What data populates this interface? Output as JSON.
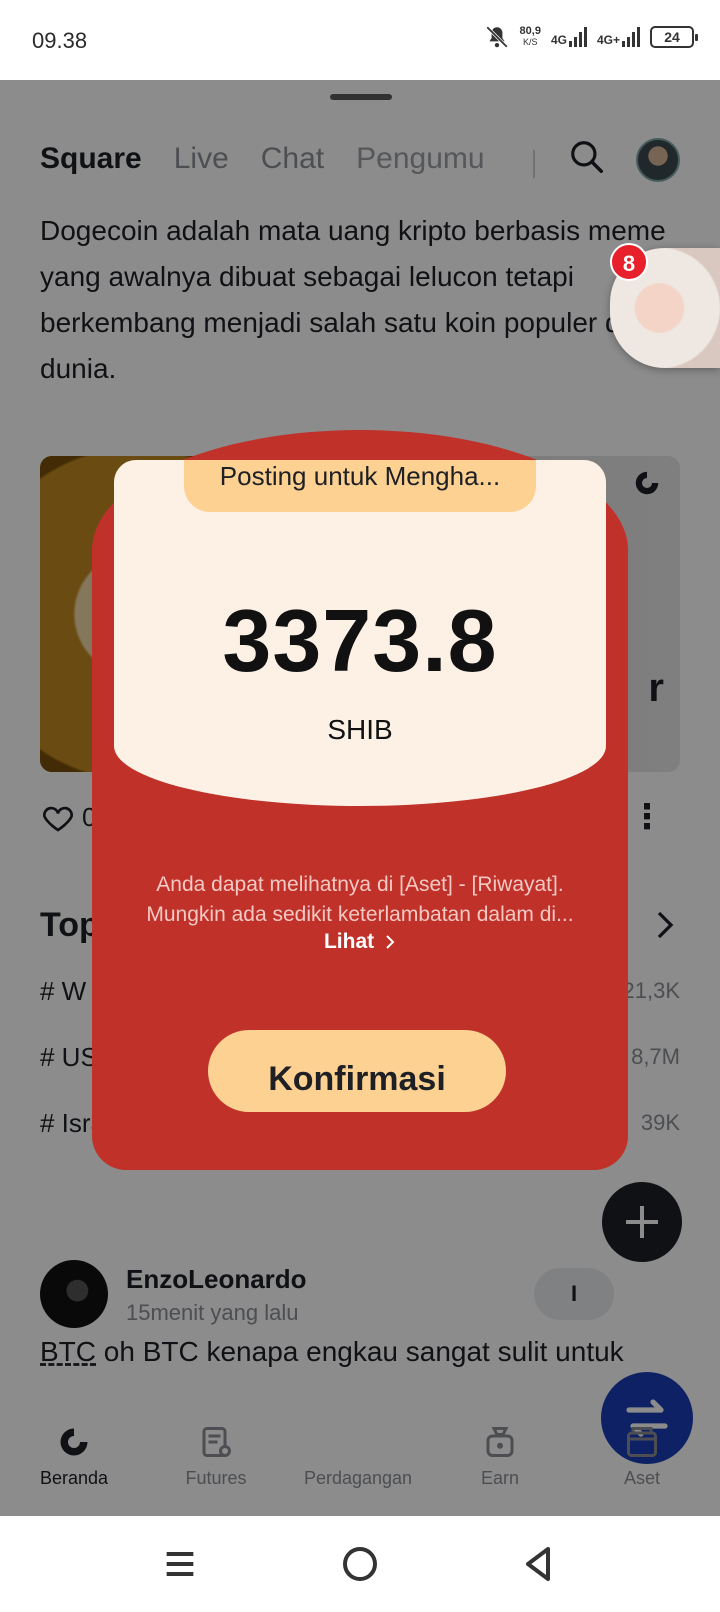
{
  "status_bar": {
    "time": "09.38",
    "net_speed_value": "80,9",
    "net_speed_unit": "K/S",
    "network_1": "4G",
    "network_2": "4G+",
    "battery": "24"
  },
  "tabs": [
    {
      "label": "Square"
    },
    {
      "label": "Live"
    },
    {
      "label": "Chat"
    },
    {
      "label": "Pengumu"
    }
  ],
  "article_text": "Dogecoin adalah mata uang kripto berbasis meme yang awalnya dibuat sebagai lelucon tetapi berkembang menjadi salah satu koin populer di dunia.",
  "card_side_text": "r",
  "like_count": "0",
  "topics": {
    "title": "Top",
    "items": [
      {
        "label": "# W",
        "count": "21,3K"
      },
      {
        "label": "# US",
        "count": "8,7M"
      },
      {
        "label": "# Isra",
        "count": "39K"
      }
    ]
  },
  "post": {
    "author": "EnzoLeonardo",
    "time": "15menit yang lalu",
    "follow_label": "I",
    "tag": "BTC",
    "text": " oh BTC kenapa engkau sangat sulit untuk"
  },
  "floating_chat": {
    "badge": "8"
  },
  "bottom_nav": [
    {
      "label": "Beranda"
    },
    {
      "label": "Futures"
    },
    {
      "label": "Perdagangan"
    },
    {
      "label": "Earn"
    },
    {
      "label": "Aset"
    }
  ],
  "modal": {
    "header": "Posting untuk Mengha...",
    "amount": "3373.8",
    "unit": "SHIB",
    "note_line1": "Anda dapat melihatnya di [Aset] - [Riwayat].",
    "note_line2": "Mungkin ada sedikit keterlambatan dalam di...",
    "link_label": "Lihat",
    "confirm_label": "Konfirmasi"
  },
  "colors": {
    "modal_red": "#bf3129",
    "modal_card": "#fdf1e5",
    "accent_yellow": "#fcd191",
    "trade_blue": "#1a3db8"
  }
}
